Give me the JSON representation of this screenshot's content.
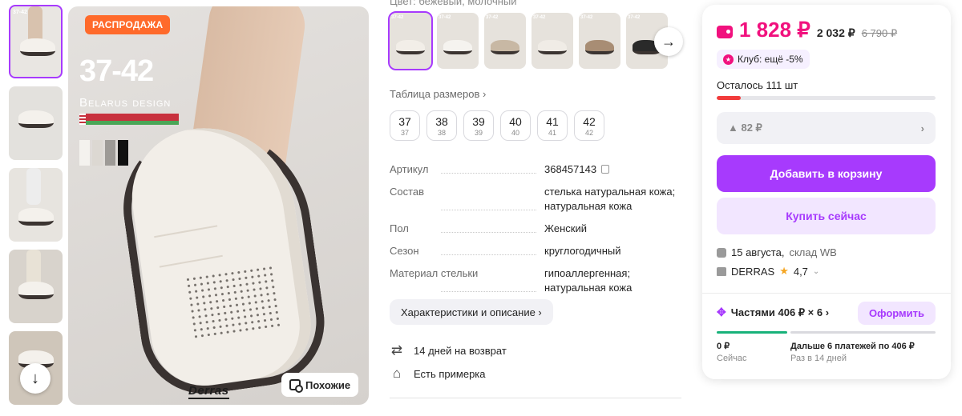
{
  "gallery": {
    "thumb_tag": "37-42",
    "badge": "РАСПРОДАЖА",
    "size_range": "37-42",
    "brand_line": "Belarus design",
    "logo": "Derras",
    "similar_label": "Похожие",
    "swatch_colors": [
      "#f4f2ee",
      "#dcd8d2",
      "#9d9a96",
      "#111111"
    ]
  },
  "colors": {
    "label_cut": "Цвет: бежевый, молочный",
    "thumb_tag": "37-42",
    "shoe_colors": [
      "#f2eee8",
      "#f5f3ef",
      "#c8b8a4",
      "#f0ece6",
      "#a88d74",
      "#2a2a2a"
    ]
  },
  "size_table": "Таблица размеров ›",
  "sizes": [
    {
      "n": "37",
      "s": "37"
    },
    {
      "n": "38",
      "s": "38"
    },
    {
      "n": "39",
      "s": "39"
    },
    {
      "n": "40",
      "s": "40"
    },
    {
      "n": "41",
      "s": "41"
    },
    {
      "n": "42",
      "s": "42"
    }
  ],
  "specs": [
    {
      "k": "Артикул",
      "v": "368457143"
    },
    {
      "k": "Состав",
      "v": "стелька натуральная кожа; натуральная кожа"
    },
    {
      "k": "Пол",
      "v": "Женский"
    },
    {
      "k": "Сезон",
      "v": "круглогодичный"
    },
    {
      "k": "Материал стельки",
      "v": "гипоаллергенная; натуральная кожа"
    }
  ],
  "char_button": "Характеристики и описание ›",
  "features": {
    "return": "14 дней на возврат",
    "fitting": "Есть примерка"
  },
  "card": {
    "price": "1 828 ₽",
    "price_wallet": "2 032 ₽",
    "price_old": "6 790 ₽",
    "club": "Клуб: ещё -5%",
    "stock": "Осталось 111 шт",
    "stock_fraction": 0.11,
    "rise": "▲ 82 ₽",
    "add_to_cart": "Добавить в корзину",
    "buy_now": "Купить сейчас",
    "delivery_date": "15 августа,",
    "delivery_wh": "склад WB",
    "seller": "DERRAS",
    "rating": "4,7",
    "installment": "Частями 406 ₽ × 6 ›",
    "apply": "Оформить",
    "now_value": "0 ₽",
    "now_label": "Сейчас",
    "later_value": "Дальше 6 платежей по 406 ₽",
    "later_label": "Раз в 14 дней",
    "accent": "#a73afd",
    "price_color": "#f1117e"
  }
}
